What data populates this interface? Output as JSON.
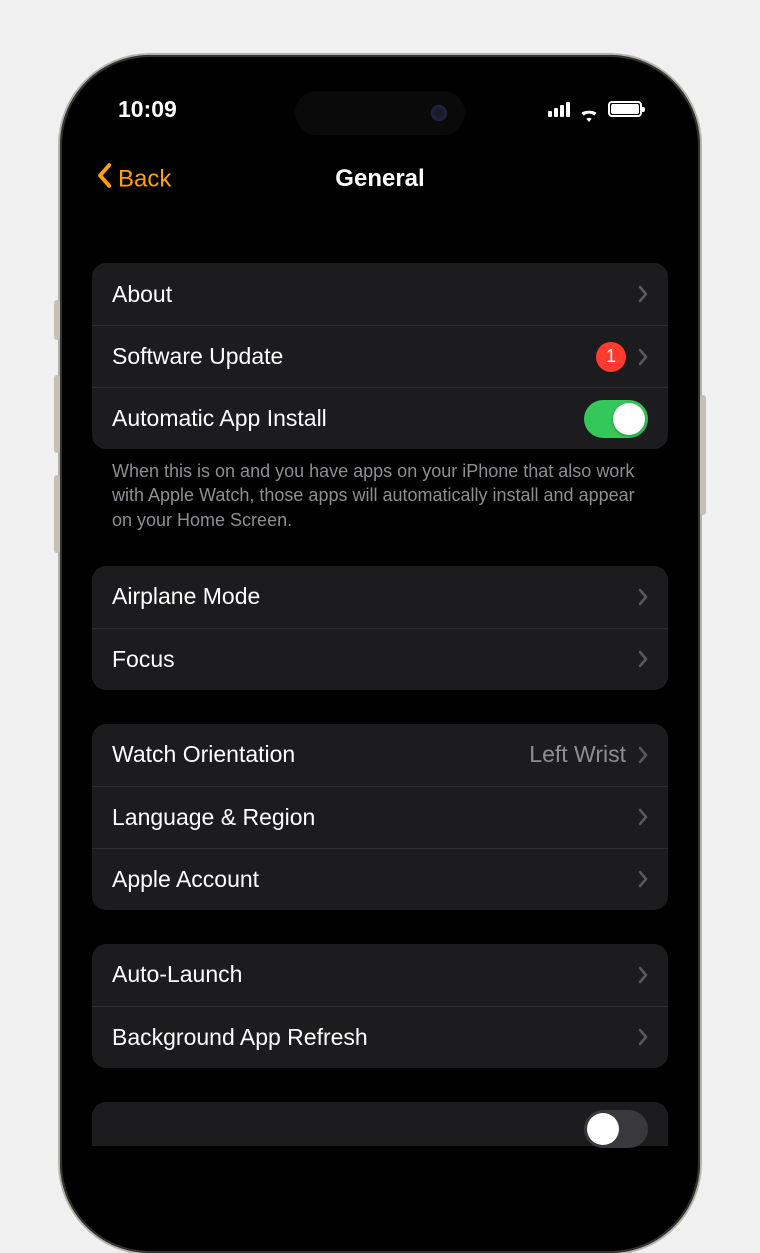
{
  "status": {
    "time": "10:09"
  },
  "nav": {
    "back": "Back",
    "title": "General"
  },
  "group1": {
    "about": "About",
    "software_update": "Software Update",
    "software_update_badge": "1",
    "auto_install": "Automatic App Install",
    "footer": "When this is on and you have apps on your iPhone that also work with Apple Watch, those apps will automatically install and appear on your Home Screen."
  },
  "group2": {
    "airplane": "Airplane Mode",
    "focus": "Focus"
  },
  "group3": {
    "orientation": "Watch Orientation",
    "orientation_value": "Left Wrist",
    "language": "Language & Region",
    "account": "Apple Account"
  },
  "group4": {
    "autolaunch": "Auto-Launch",
    "bg_refresh": "Background App Refresh"
  }
}
